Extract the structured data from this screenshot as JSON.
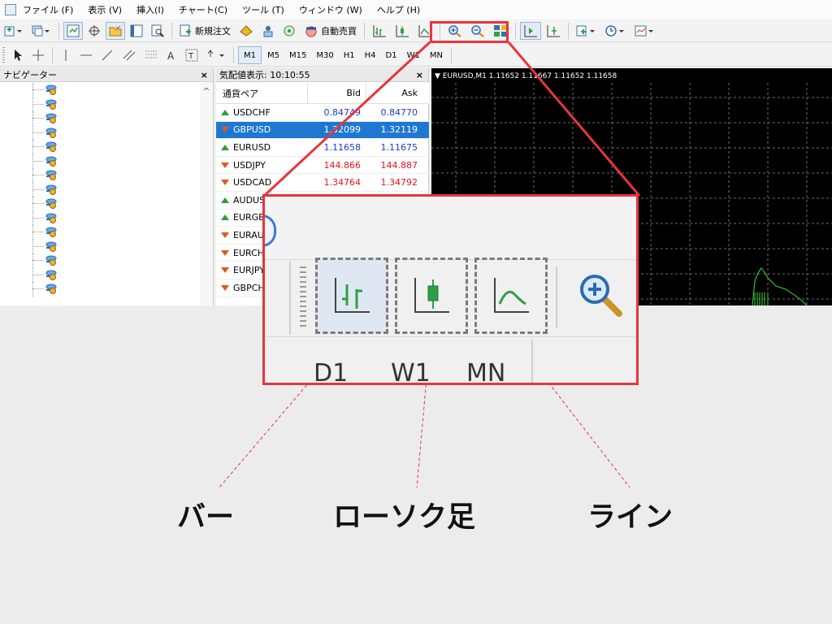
{
  "menu": [
    "ファイル (F)",
    "表示 (V)",
    "挿入(I)",
    "チャート(C)",
    "ツール (T)",
    "ウィンドウ (W)",
    "ヘルプ (H)"
  ],
  "toolbar": {
    "new_order": "新規注文",
    "auto_trade": "自動売買"
  },
  "timeframes": [
    "M1",
    "M5",
    "M15",
    "M30",
    "H1",
    "H4",
    "D1",
    "W1",
    "MN"
  ],
  "navigator": {
    "title": "ナビゲーター",
    "close": "×"
  },
  "market_watch": {
    "title": "気配値表示: 10:10:55",
    "close": "×",
    "headers": {
      "symbol": "通貨ペア",
      "bid": "Bid",
      "ask": "Ask"
    },
    "rows": [
      {
        "symbol": "USDCHF",
        "dir": "up",
        "bid": "0.84749",
        "ask": "0.84770",
        "color": "blue"
      },
      {
        "symbol": "GBPUSD",
        "dir": "down",
        "bid": "1.32099",
        "ask": "1.32119",
        "color": "blue",
        "selected": true
      },
      {
        "symbol": "EURUSD",
        "dir": "up",
        "bid": "1.11658",
        "ask": "1.11675",
        "color": "blue"
      },
      {
        "symbol": "USDJPY",
        "dir": "down",
        "bid": "144.866",
        "ask": "144.887",
        "color": "red"
      },
      {
        "symbol": "USDCAD",
        "dir": "down",
        "bid": "1.34764",
        "ask": "1.34792",
        "color": "red"
      },
      {
        "symbol": "AUDUSD",
        "dir": "up",
        "bid": "",
        "ask": "",
        "color": "blue"
      },
      {
        "symbol": "EURGBP",
        "dir": "up",
        "bid": "",
        "ask": "",
        "color": "blue"
      },
      {
        "symbol": "EURAUD",
        "dir": "down",
        "bid": "",
        "ask": "",
        "color": "red"
      },
      {
        "symbol": "EURCHF",
        "dir": "down",
        "bid": "",
        "ask": "",
        "color": "red"
      },
      {
        "symbol": "EURJPY",
        "dir": "down",
        "bid": "",
        "ask": "",
        "color": "red"
      },
      {
        "symbol": "GBPCHF",
        "dir": "down",
        "bid": "",
        "ask": "",
        "color": "red"
      }
    ]
  },
  "chart": {
    "title": "EURUSD,M1  1.11652 1.11667 1.11652 1.11658"
  },
  "zoom": {
    "timeframes": [
      "D1",
      "W1",
      "MN"
    ]
  },
  "callouts": {
    "bar": "バー",
    "candle": "ローソク足",
    "line": "ライン"
  },
  "colors": {
    "accent": "#e8343c",
    "selection": "#1e78d2",
    "chart_bg": "#000000",
    "chart_line": "#3ddc3d"
  }
}
